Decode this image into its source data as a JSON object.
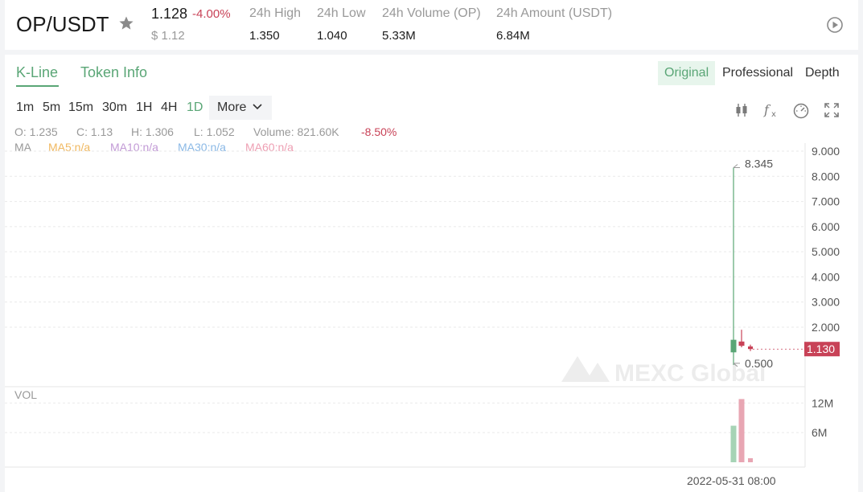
{
  "header": {
    "pair": "OP/USDT",
    "price": "1.128",
    "change": "-4.00%",
    "fiat_price": "$ 1.12",
    "stats": [
      {
        "label": "24h High",
        "value": "1.350"
      },
      {
        "label": "24h Low",
        "value": "1.040"
      },
      {
        "label": "24h Volume (OP)",
        "value": "5.33M"
      },
      {
        "label": "24h Amount (USDT)",
        "value": "6.84M"
      }
    ]
  },
  "tabs": {
    "kline": "K-Line",
    "token_info": "Token Info"
  },
  "views": {
    "original": "Original",
    "professional": "Professional",
    "depth": "Depth"
  },
  "timeframes": [
    "1m",
    "5m",
    "15m",
    "30m",
    "1H",
    "4H",
    "1D"
  ],
  "active_timeframe": "1D",
  "more_label": "More",
  "ohlc": {
    "o_label": "O:",
    "o": "1.235",
    "c_label": "C:",
    "c": "1.13",
    "h_label": "H:",
    "h": "1.306",
    "l_label": "L:",
    "l": "1.052",
    "vol_label": "Volume:",
    "vol": "821.60K",
    "change": "-8.50%"
  },
  "ma": {
    "label": "MA",
    "ma5": "MA5:n/a",
    "ma10": "MA10:n/a",
    "ma30": "MA30:n/a",
    "ma60": "MA60:n/a"
  },
  "colors": {
    "up": "#5aa676",
    "down": "#c84257",
    "vol_up": "#a6d3b5",
    "vol_down": "#e8a6b3",
    "ma5": "#f0b860",
    "ma10": "#c29ad6",
    "ma30": "#8bb9e6",
    "ma60": "#ee9fb3"
  },
  "watermark": "MEXC Global",
  "chart_data": {
    "type": "candlestick",
    "price_axis": {
      "ticks": [
        "9.000",
        "8.000",
        "7.000",
        "6.000",
        "5.000",
        "4.000",
        "3.000",
        "2.000"
      ],
      "min": 0.5,
      "max": 9.0
    },
    "volume_axis_label": "VOL",
    "volume_ticks": [
      "12M",
      "6M"
    ],
    "max_label": "8.345",
    "min_label": "0.500",
    "last_price_label": "1.130",
    "date_label": "2022-05-31 08:00",
    "candles": [
      {
        "open": 1.0,
        "close": 1.5,
        "high": 8.345,
        "low": 0.5,
        "volume": 7400000
      },
      {
        "open": 1.43,
        "close": 1.26,
        "high": 1.9,
        "low": 1.2,
        "volume": 12800000
      },
      {
        "open": 1.235,
        "close": 1.13,
        "high": 1.306,
        "low": 1.052,
        "volume": 821600
      }
    ],
    "volume_max": 14000000
  }
}
